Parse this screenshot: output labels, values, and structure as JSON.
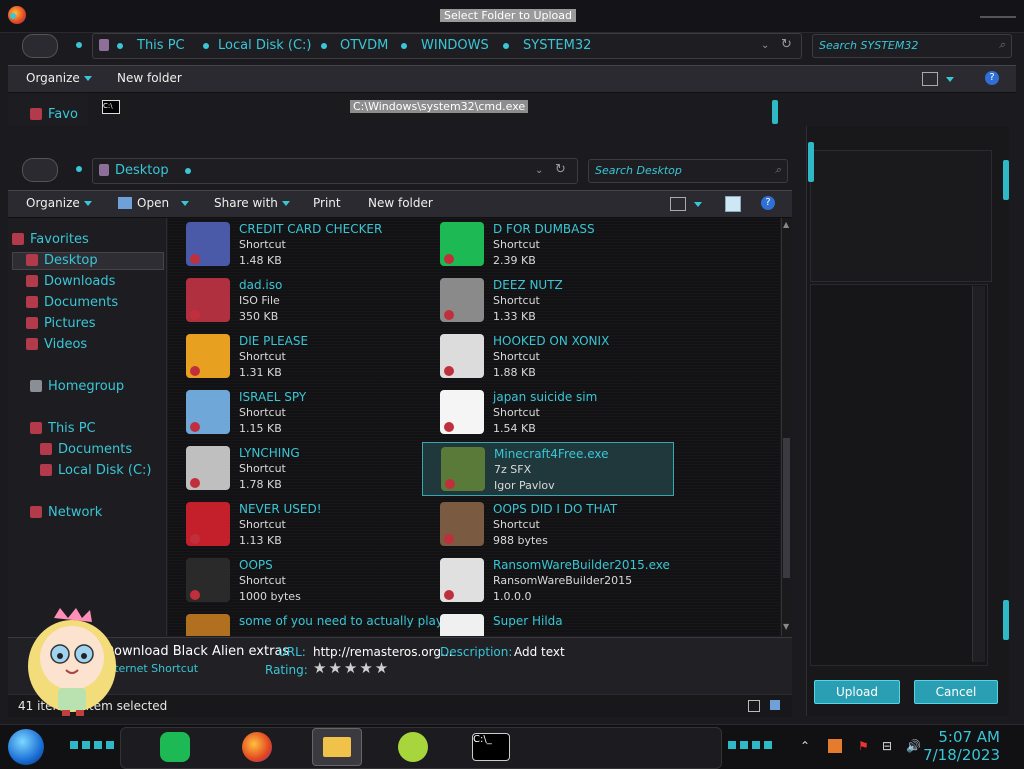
{
  "upload_dialog": {
    "title": "Select Folder to Upload",
    "breadcrumb": [
      "This PC",
      "Local Disk (C:)",
      "OTVDM",
      "WINDOWS",
      "SYSTEM32"
    ],
    "search_placeholder": "Search SYSTEM32",
    "toolbar": {
      "organize": "Organize",
      "new_folder": "New folder"
    },
    "nav_partial": "Favo",
    "buttons": {
      "upload": "Upload",
      "cancel": "Cancel"
    }
  },
  "cmd_window": {
    "title": "C:\\Windows\\system32\\cmd.exe"
  },
  "explorer": {
    "breadcrumb": [
      "Desktop"
    ],
    "search_placeholder": "Search Desktop",
    "toolbar": {
      "organize": "Organize",
      "open": "Open",
      "share_with": "Share with",
      "print": "Print",
      "new_folder": "New folder"
    },
    "nav": {
      "favorites": "Favorites",
      "desktop": "Desktop",
      "downloads": "Downloads",
      "documents": "Documents",
      "pictures": "Pictures",
      "videos": "Videos",
      "homegroup": "Homegroup",
      "this_pc": "This PC",
      "pc_documents": "Documents",
      "local_disk": "Local Disk (C:)",
      "network": "Network"
    },
    "files": [
      {
        "name": "CREDIT CARD CHECKER",
        "type": "Shortcut",
        "size": "1.48 KB",
        "color": "#4a5aa8"
      },
      {
        "name": "D FOR DUMBASS",
        "type": "Shortcut",
        "size": "2.39 KB",
        "color": "#1db954"
      },
      {
        "name": "dad.iso",
        "type": "ISO File",
        "size": "350 KB",
        "color": "#b03040"
      },
      {
        "name": "DEEZ NUTZ",
        "type": "Shortcut",
        "size": "1.33 KB",
        "color": "#8a8a8a"
      },
      {
        "name": "DIE PLEASE",
        "type": "Shortcut",
        "size": "1.31 KB",
        "color": "#e8a020"
      },
      {
        "name": "HOOKED ON XONIX",
        "type": "Shortcut",
        "size": "1.88 KB",
        "color": "#dcdcdc"
      },
      {
        "name": "ISRAEL SPY",
        "type": "Shortcut",
        "size": "1.15 KB",
        "color": "#6fa7d8"
      },
      {
        "name": "japan suicide sim",
        "type": "Shortcut",
        "size": "1.54 KB",
        "color": "#f5f5f5"
      },
      {
        "name": "LYNCHING",
        "type": "Shortcut",
        "size": "1.78 KB",
        "color": "#bfbfbf"
      },
      {
        "name": "Minecraft4Free.exe",
        "type": "7z SFX",
        "size": "Igor Pavlov",
        "color": "#5a7a3a"
      },
      {
        "name": "NEVER USED!",
        "type": "Shortcut",
        "size": "1.13 KB",
        "color": "#c4202c"
      },
      {
        "name": "OOPS DID I DO THAT",
        "type": "Shortcut",
        "size": "988 bytes",
        "color": "#7a5a40"
      },
      {
        "name": "OOPS",
        "type": "Shortcut",
        "size": "1000 bytes",
        "color": "#2a2a2a"
      },
      {
        "name": "RansomWareBuilder2015.exe",
        "type": "RansomWareBuilder2015",
        "size": "1.0.0.0",
        "color": "#e0e0e0"
      },
      {
        "name": "some of you need to actually play this",
        "type": "",
        "size": "",
        "color": "#b07020"
      },
      {
        "name": "Super Hilda",
        "type": "",
        "size": "",
        "color": "#f0f0f0"
      }
    ],
    "details": {
      "title": "Download Black Alien extras",
      "subtitle": "Internet Shortcut",
      "url_label": "URL:",
      "url_value": "http://remasteros.org...",
      "description_label": "Description:",
      "description_value": "Add text",
      "rating_label": "Rating:",
      "rating_stars": "★★★★★"
    },
    "status": "41 items    1 item selected"
  },
  "taskbar": {
    "time": "5:07 AM",
    "date": "7/18/2023",
    "icons": [
      "app-green-icon",
      "firefox-icon",
      "file-explorer-icon",
      "lime-icon",
      "cmd-icon"
    ]
  },
  "colors": {
    "accent": "#39c6d6",
    "upload_button": "#2a9fb3"
  }
}
